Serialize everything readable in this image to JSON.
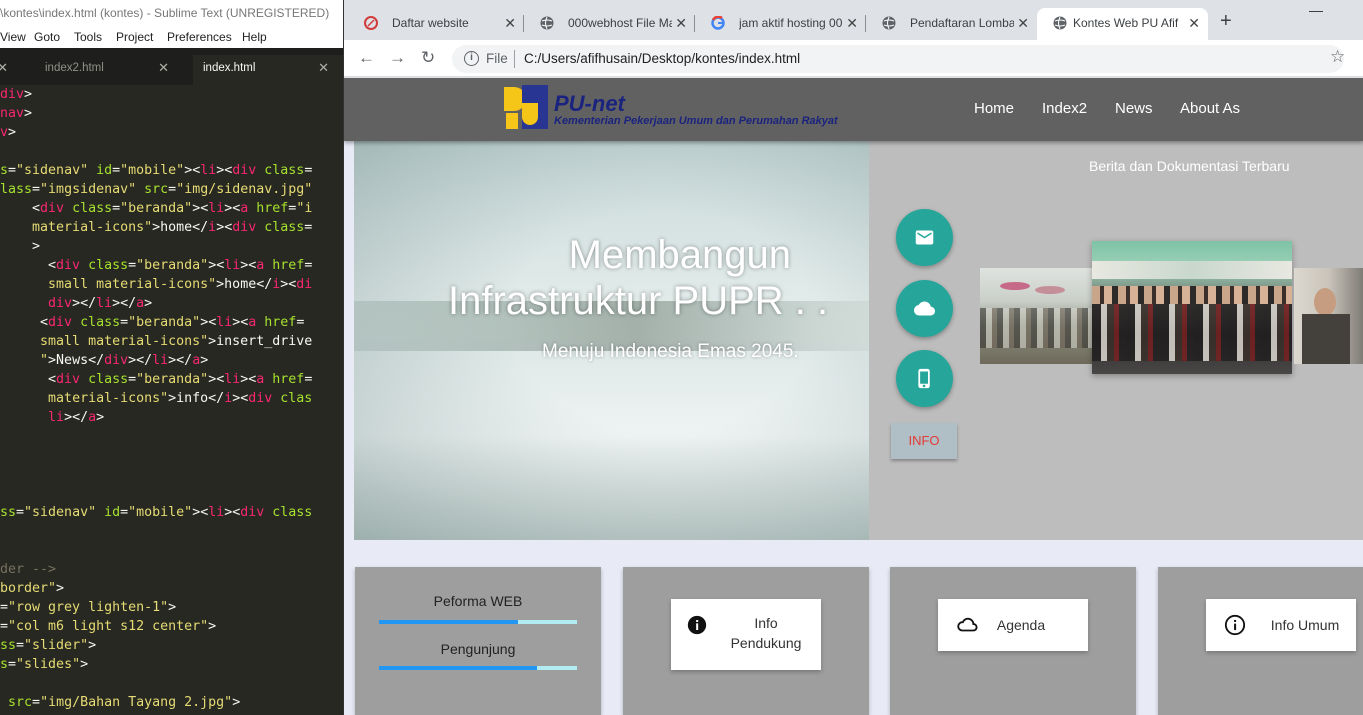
{
  "sublime": {
    "title": "\\kontes\\index.html (kontes) - Sublime Text (UNREGISTERED)",
    "menu": [
      "View",
      "Goto",
      "Tools",
      "Project",
      "Preferences",
      "Help"
    ],
    "tabs": [
      {
        "label": "",
        "active": false
      },
      {
        "label": "index2.html",
        "active": false
      },
      {
        "label": "index.html",
        "active": true
      }
    ]
  },
  "chrome": {
    "tabs": [
      {
        "label": "Daftar website",
        "icon": "pen-icon",
        "active": false
      },
      {
        "label": "000webhost File Ma",
        "icon": "globe-icon",
        "active": false
      },
      {
        "label": "jam aktif hosting 00",
        "icon": "google-icon",
        "active": false
      },
      {
        "label": "Pendaftaran Lomba",
        "icon": "globe-icon",
        "active": false
      },
      {
        "label": "Kontes Web PU Afif",
        "icon": "globe-icon",
        "active": true
      }
    ],
    "scheme": "File",
    "url": "C:/Users/afifhusain/Desktop/kontes/index.html"
  },
  "site": {
    "brand": "PU-net",
    "brand_sub": "Kementerian Pekerjaan Umum dan Perumahan Rakyat",
    "nav": [
      "Home",
      "Index2",
      "News",
      "About As"
    ],
    "hero_line1": "Membangun",
    "hero_line2": "Infrastruktur PUPR . .",
    "hero_line3": "Menuju Indonesia Emas 2045.",
    "news_heading": "Berita dan Dokumentasi Terbaru",
    "info_button": "INFO",
    "fab_icons": [
      "mail-icon",
      "cloud-icon",
      "phone-icon"
    ],
    "progress": [
      {
        "label": "Peforma WEB",
        "value": 0.7
      },
      {
        "label": "Pengunjung",
        "value": 0.8
      }
    ],
    "cards": [
      {
        "label": "Info Pendukung",
        "icon": "info-filled-icon"
      },
      {
        "label": "Agenda",
        "icon": "cloud-outline-icon"
      },
      {
        "label": "Info Umum",
        "icon": "info-outline-icon"
      }
    ]
  },
  "colors": {
    "navbar": "#616161",
    "teal": "#26a69a",
    "panel": "#bdbdbd",
    "card": "#9e9e9e",
    "progress": "#2196f3",
    "info_text": "#e53935"
  }
}
